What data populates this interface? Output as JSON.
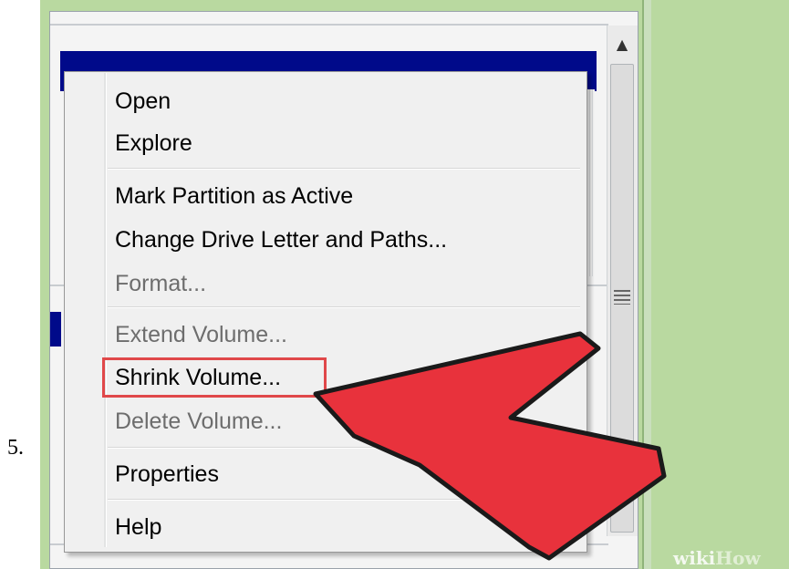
{
  "step_number": "5.",
  "menu": {
    "items": [
      {
        "label": "Open",
        "disabled": false
      },
      {
        "label": "Explore",
        "disabled": false
      },
      {
        "label": "Mark Partition as Active",
        "disabled": false
      },
      {
        "label": "Change Drive Letter and Paths...",
        "disabled": false
      },
      {
        "label": "Format...",
        "disabled": true
      },
      {
        "label": "Extend Volume...",
        "disabled": true
      },
      {
        "label": "Shrink Volume...",
        "disabled": false,
        "highlighted": true
      },
      {
        "label": "Delete Volume...",
        "disabled": true
      },
      {
        "label": "Properties",
        "disabled": false
      },
      {
        "label": "Help",
        "disabled": false
      }
    ]
  },
  "scrollbar": {
    "up_glyph": "▲"
  },
  "watermark": {
    "part1": "wiki",
    "part2": "How"
  },
  "colors": {
    "selection_bar": "#000a8a",
    "highlight_box": "#e0484a",
    "arrow": "#e8323c",
    "background": "#b9d9a0"
  }
}
